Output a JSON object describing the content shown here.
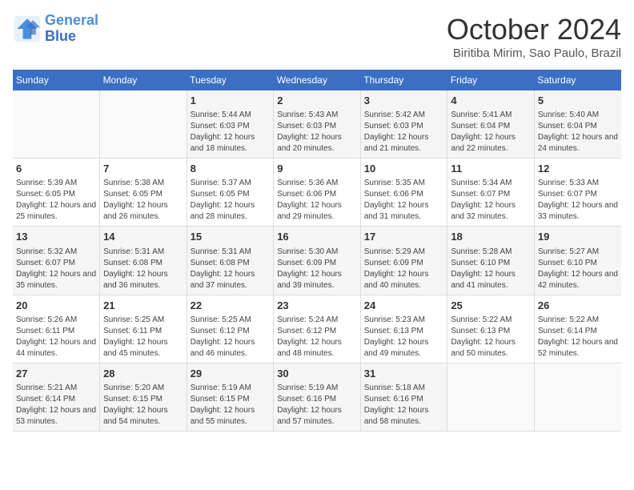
{
  "header": {
    "logo_line1": "General",
    "logo_line2": "Blue",
    "month": "October 2024",
    "location": "Biritiba Mirim, Sao Paulo, Brazil"
  },
  "weekdays": [
    "Sunday",
    "Monday",
    "Tuesday",
    "Wednesday",
    "Thursday",
    "Friday",
    "Saturday"
  ],
  "weeks": [
    [
      {
        "day": "",
        "info": ""
      },
      {
        "day": "",
        "info": ""
      },
      {
        "day": "1",
        "info": "Sunrise: 5:44 AM\nSunset: 6:03 PM\nDaylight: 12 hours and 18 minutes."
      },
      {
        "day": "2",
        "info": "Sunrise: 5:43 AM\nSunset: 6:03 PM\nDaylight: 12 hours and 20 minutes."
      },
      {
        "day": "3",
        "info": "Sunrise: 5:42 AM\nSunset: 6:03 PM\nDaylight: 12 hours and 21 minutes."
      },
      {
        "day": "4",
        "info": "Sunrise: 5:41 AM\nSunset: 6:04 PM\nDaylight: 12 hours and 22 minutes."
      },
      {
        "day": "5",
        "info": "Sunrise: 5:40 AM\nSunset: 6:04 PM\nDaylight: 12 hours and 24 minutes."
      }
    ],
    [
      {
        "day": "6",
        "info": "Sunrise: 5:39 AM\nSunset: 6:05 PM\nDaylight: 12 hours and 25 minutes."
      },
      {
        "day": "7",
        "info": "Sunrise: 5:38 AM\nSunset: 6:05 PM\nDaylight: 12 hours and 26 minutes."
      },
      {
        "day": "8",
        "info": "Sunrise: 5:37 AM\nSunset: 6:05 PM\nDaylight: 12 hours and 28 minutes."
      },
      {
        "day": "9",
        "info": "Sunrise: 5:36 AM\nSunset: 6:06 PM\nDaylight: 12 hours and 29 minutes."
      },
      {
        "day": "10",
        "info": "Sunrise: 5:35 AM\nSunset: 6:06 PM\nDaylight: 12 hours and 31 minutes."
      },
      {
        "day": "11",
        "info": "Sunrise: 5:34 AM\nSunset: 6:07 PM\nDaylight: 12 hours and 32 minutes."
      },
      {
        "day": "12",
        "info": "Sunrise: 5:33 AM\nSunset: 6:07 PM\nDaylight: 12 hours and 33 minutes."
      }
    ],
    [
      {
        "day": "13",
        "info": "Sunrise: 5:32 AM\nSunset: 6:07 PM\nDaylight: 12 hours and 35 minutes."
      },
      {
        "day": "14",
        "info": "Sunrise: 5:31 AM\nSunset: 6:08 PM\nDaylight: 12 hours and 36 minutes."
      },
      {
        "day": "15",
        "info": "Sunrise: 5:31 AM\nSunset: 6:08 PM\nDaylight: 12 hours and 37 minutes."
      },
      {
        "day": "16",
        "info": "Sunrise: 5:30 AM\nSunset: 6:09 PM\nDaylight: 12 hours and 39 minutes."
      },
      {
        "day": "17",
        "info": "Sunrise: 5:29 AM\nSunset: 6:09 PM\nDaylight: 12 hours and 40 minutes."
      },
      {
        "day": "18",
        "info": "Sunrise: 5:28 AM\nSunset: 6:10 PM\nDaylight: 12 hours and 41 minutes."
      },
      {
        "day": "19",
        "info": "Sunrise: 5:27 AM\nSunset: 6:10 PM\nDaylight: 12 hours and 42 minutes."
      }
    ],
    [
      {
        "day": "20",
        "info": "Sunrise: 5:26 AM\nSunset: 6:11 PM\nDaylight: 12 hours and 44 minutes."
      },
      {
        "day": "21",
        "info": "Sunrise: 5:25 AM\nSunset: 6:11 PM\nDaylight: 12 hours and 45 minutes."
      },
      {
        "day": "22",
        "info": "Sunrise: 5:25 AM\nSunset: 6:12 PM\nDaylight: 12 hours and 46 minutes."
      },
      {
        "day": "23",
        "info": "Sunrise: 5:24 AM\nSunset: 6:12 PM\nDaylight: 12 hours and 48 minutes."
      },
      {
        "day": "24",
        "info": "Sunrise: 5:23 AM\nSunset: 6:13 PM\nDaylight: 12 hours and 49 minutes."
      },
      {
        "day": "25",
        "info": "Sunrise: 5:22 AM\nSunset: 6:13 PM\nDaylight: 12 hours and 50 minutes."
      },
      {
        "day": "26",
        "info": "Sunrise: 5:22 AM\nSunset: 6:14 PM\nDaylight: 12 hours and 52 minutes."
      }
    ],
    [
      {
        "day": "27",
        "info": "Sunrise: 5:21 AM\nSunset: 6:14 PM\nDaylight: 12 hours and 53 minutes."
      },
      {
        "day": "28",
        "info": "Sunrise: 5:20 AM\nSunset: 6:15 PM\nDaylight: 12 hours and 54 minutes."
      },
      {
        "day": "29",
        "info": "Sunrise: 5:19 AM\nSunset: 6:15 PM\nDaylight: 12 hours and 55 minutes."
      },
      {
        "day": "30",
        "info": "Sunrise: 5:19 AM\nSunset: 6:16 PM\nDaylight: 12 hours and 57 minutes."
      },
      {
        "day": "31",
        "info": "Sunrise: 5:18 AM\nSunset: 6:16 PM\nDaylight: 12 hours and 58 minutes."
      },
      {
        "day": "",
        "info": ""
      },
      {
        "day": "",
        "info": ""
      }
    ]
  ]
}
